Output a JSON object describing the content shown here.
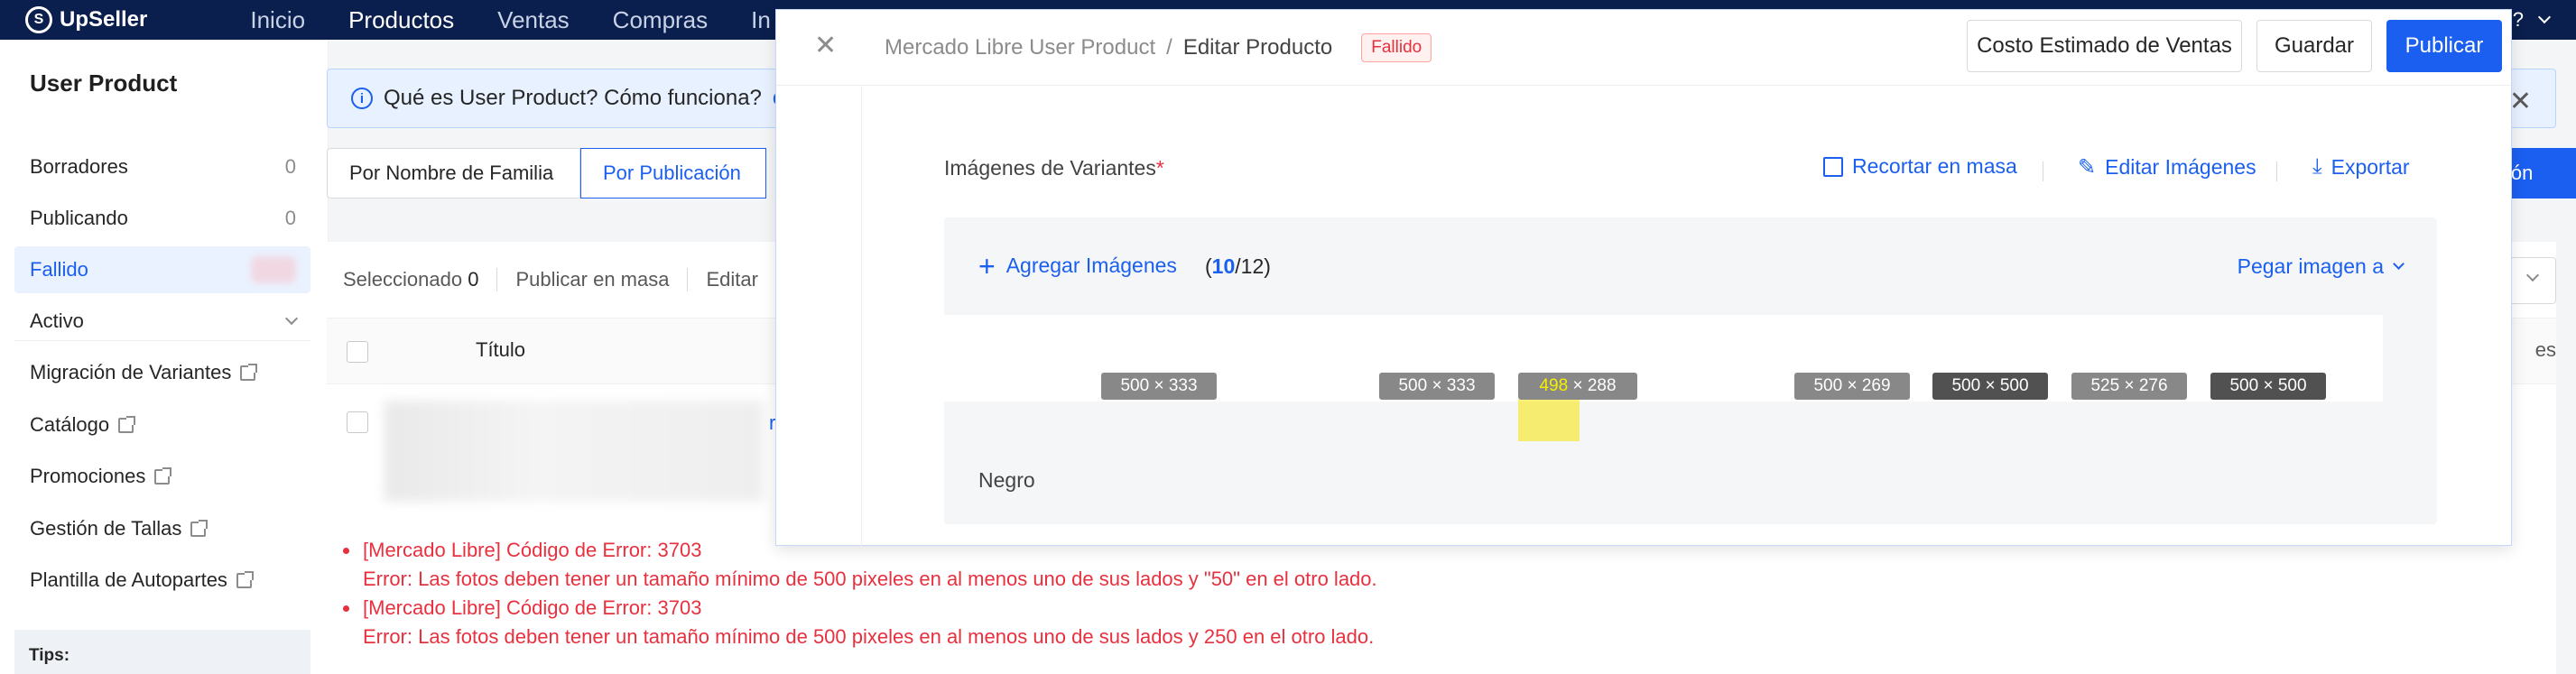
{
  "topnav": {
    "brand": "UpSeller",
    "items": [
      "Inicio",
      "Productos",
      "Ventas",
      "Compras",
      "In"
    ],
    "active_index": 1
  },
  "sidebar": {
    "title": "User Product",
    "items": [
      {
        "label": "Borradores",
        "count": "0"
      },
      {
        "label": "Publicando",
        "count": "0"
      },
      {
        "label": "Fallido",
        "count": ""
      },
      {
        "label": "Activo",
        "count": ""
      }
    ],
    "links": [
      "Migración de Variantes",
      "Catálogo",
      "Promociones",
      "Gestión de Tallas",
      "Plantilla de Autopartes"
    ],
    "tips": "Tips:"
  },
  "info_bar": {
    "text": "Qué es User Product? Cómo funciona?",
    "link": "con"
  },
  "filters": {
    "by_family": "Por Nombre de Familia",
    "by_publication": "Por Publicación",
    "right_button": "ción"
  },
  "table": {
    "selected_label": "Seleccionado",
    "selected_count": "0",
    "bulk_publish": "Publicar en masa",
    "edit": "Editar",
    "col_title": "Título",
    "col_right": "es",
    "row_fragment": "r"
  },
  "errors": [
    {
      "title": "[Mercado Libre] Código de Error: 3703",
      "detail": "Error: Las fotos deben tener un tamaño mínimo de 500 pixeles en al menos uno de sus lados y \"50\" en el otro lado."
    },
    {
      "title": "[Mercado Libre] Código de Error: 3703",
      "detail": "Error: Las fotos deben tener un tamaño mínimo de 500 pixeles en al menos uno de sus lados y 250 en el otro lado."
    }
  ],
  "modal": {
    "breadcrumb_parent": "Mercado Libre User Product",
    "breadcrumb_sep": "/",
    "breadcrumb_current": "Editar Producto",
    "status": "Fallido",
    "btn_cost": "Costo Estimado de Ventas",
    "btn_save": "Guardar",
    "btn_publish": "Publicar",
    "section_title": "Imágenes de Variantes",
    "required_mark": "*",
    "action_crop": "Recortar en masa",
    "action_edit": "Editar Imágenes",
    "action_export": "Exportar",
    "add_images": "Agregar Imágenes",
    "count_open": "(",
    "count_current": "10",
    "count_rest": "/12)",
    "paste_image": "Pegar imagen a",
    "thumbnails": [
      "500 × 333",
      "500 × 333",
      "498 × 288",
      "500 × 269",
      "500 × 500",
      "525 × 276",
      "500 × 500"
    ],
    "highlight_left": "498",
    "highlight_right": "× 288",
    "variant": "Negro"
  },
  "colors": {
    "primary": "#1a5ff0",
    "error": "#e8303e",
    "nav_bg": "#0a1f4d"
  }
}
